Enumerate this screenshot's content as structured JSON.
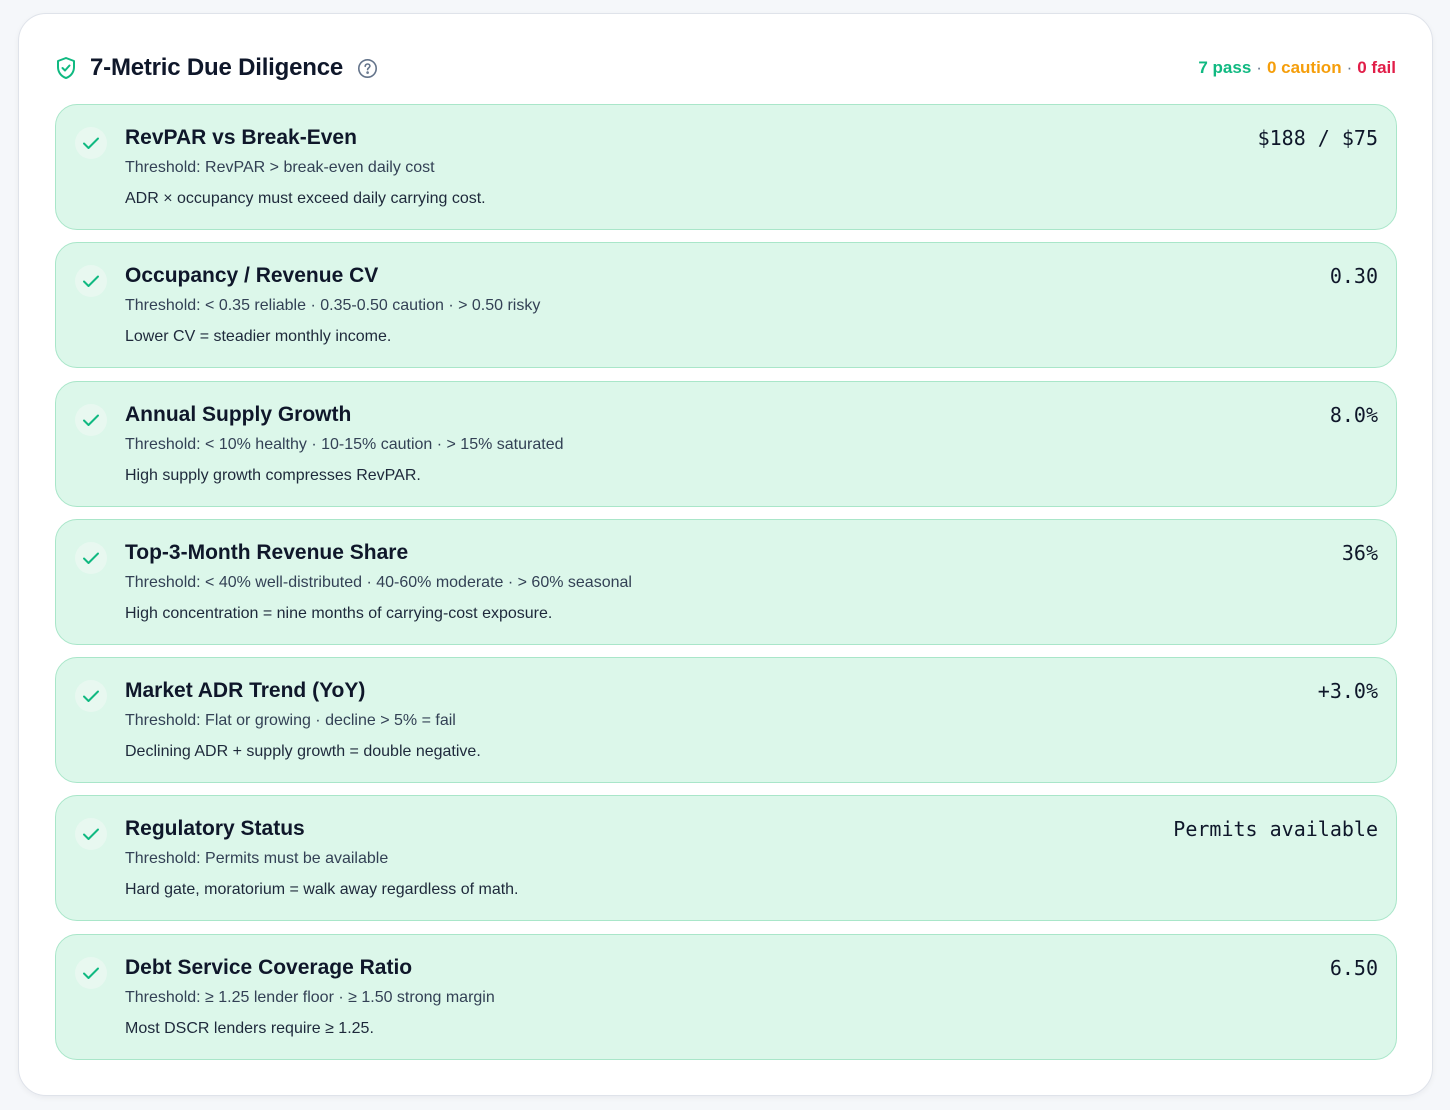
{
  "header": {
    "title": "7-Metric Due Diligence",
    "summary": {
      "pass": "7 pass",
      "separator": "·",
      "caution": "0 caution",
      "fail": "0 fail"
    }
  },
  "icons": {
    "header": "shield-check-icon",
    "help": "help-circle-icon",
    "row_status": "check-icon"
  },
  "colors": {
    "pass": "#10b981",
    "caution": "#f59e0b",
    "fail": "#e11d48",
    "row_background": "#dcf7ea",
    "row_border": "#a9e6c9"
  },
  "metrics": [
    {
      "title": "RevPAR vs Break-Even",
      "threshold": "Threshold: RevPAR > break-even daily cost",
      "note": "ADR × occupancy must exceed daily carrying cost.",
      "value": "$188 / $75",
      "status": "pass"
    },
    {
      "title": "Occupancy / Revenue CV",
      "threshold": "Threshold: < 0.35 reliable · 0.35-0.50 caution · > 0.50 risky",
      "note": "Lower CV = steadier monthly income.",
      "value": "0.30",
      "status": "pass"
    },
    {
      "title": "Annual Supply Growth",
      "threshold": "Threshold: < 10% healthy · 10-15% caution · > 15% saturated",
      "note": "High supply growth compresses RevPAR.",
      "value": "8.0%",
      "status": "pass"
    },
    {
      "title": "Top-3-Month Revenue Share",
      "threshold": "Threshold: < 40% well-distributed · 40-60% moderate · > 60% seasonal",
      "note": "High concentration = nine months of carrying-cost exposure.",
      "value": "36%",
      "status": "pass"
    },
    {
      "title": "Market ADR Trend (YoY)",
      "threshold": "Threshold: Flat or growing · decline > 5% = fail",
      "note": "Declining ADR + supply growth = double negative.",
      "value": "+3.0%",
      "status": "pass"
    },
    {
      "title": "Regulatory Status",
      "threshold": "Threshold: Permits must be available",
      "note": "Hard gate, moratorium = walk away regardless of math.",
      "value": "Permits available",
      "status": "pass"
    },
    {
      "title": "Debt Service Coverage Ratio",
      "threshold": "Threshold: ≥ 1.25 lender floor · ≥ 1.50 strong margin",
      "note": "Most DSCR lenders require ≥ 1.25.",
      "value": "6.50",
      "status": "pass"
    }
  ]
}
